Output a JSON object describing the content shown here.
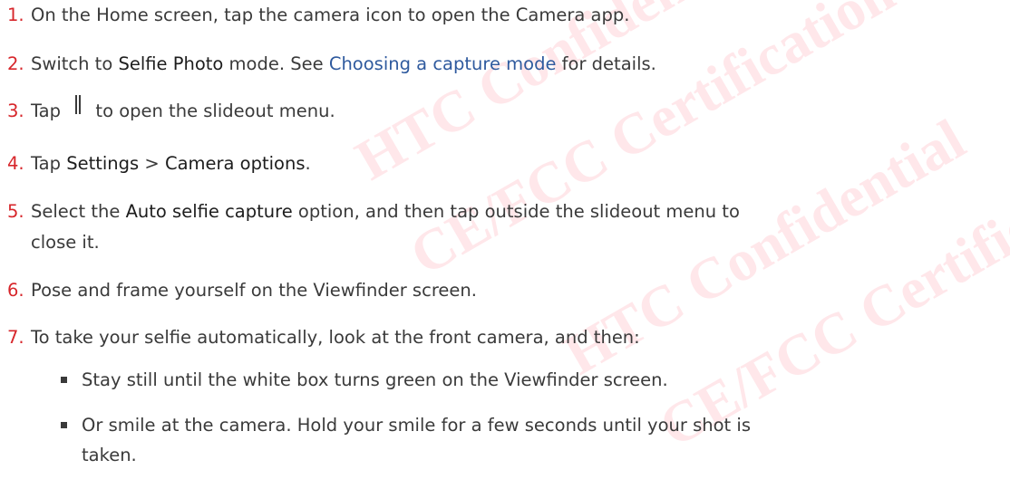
{
  "watermark": {
    "lines": [
      "HTC Confidential",
      "CE/FCC Certification",
      "HTC Confidential",
      "CE/FCC Certification"
    ]
  },
  "steps": [
    {
      "num": "1.",
      "parts": [
        "On the Home screen, tap the camera icon to open the Camera app."
      ]
    },
    {
      "num": "2.",
      "parts": [
        "Switch to ",
        "Selfie Photo",
        " mode. See ",
        "Choosing a capture mode",
        " for details."
      ]
    },
    {
      "num": "3.",
      "parts": [
        "Tap ",
        "to open the slideout menu."
      ]
    },
    {
      "num": "4.",
      "parts": [
        "Tap ",
        "Settings",
        " > ",
        "Camera options",
        "."
      ]
    },
    {
      "num": "5.",
      "parts": [
        "Select the ",
        "Auto selfie capture",
        " option, and then tap outside the slideout menu to",
        "close it."
      ]
    },
    {
      "num": "6.",
      "parts": [
        "Pose and frame yourself on the Viewfinder screen."
      ]
    },
    {
      "num": "7.",
      "parts": [
        "To take your selfie automatically, look at the front camera, and then:"
      ]
    }
  ],
  "bullets": [
    {
      "lines": [
        "Stay still until the white box turns green on the Viewfinder screen."
      ]
    },
    {
      "lines": [
        "Or smile at the camera. Hold your smile for a few seconds until your shot is",
        "taken."
      ]
    }
  ],
  "icons": {
    "slideout": "slideout-menu-icon"
  }
}
